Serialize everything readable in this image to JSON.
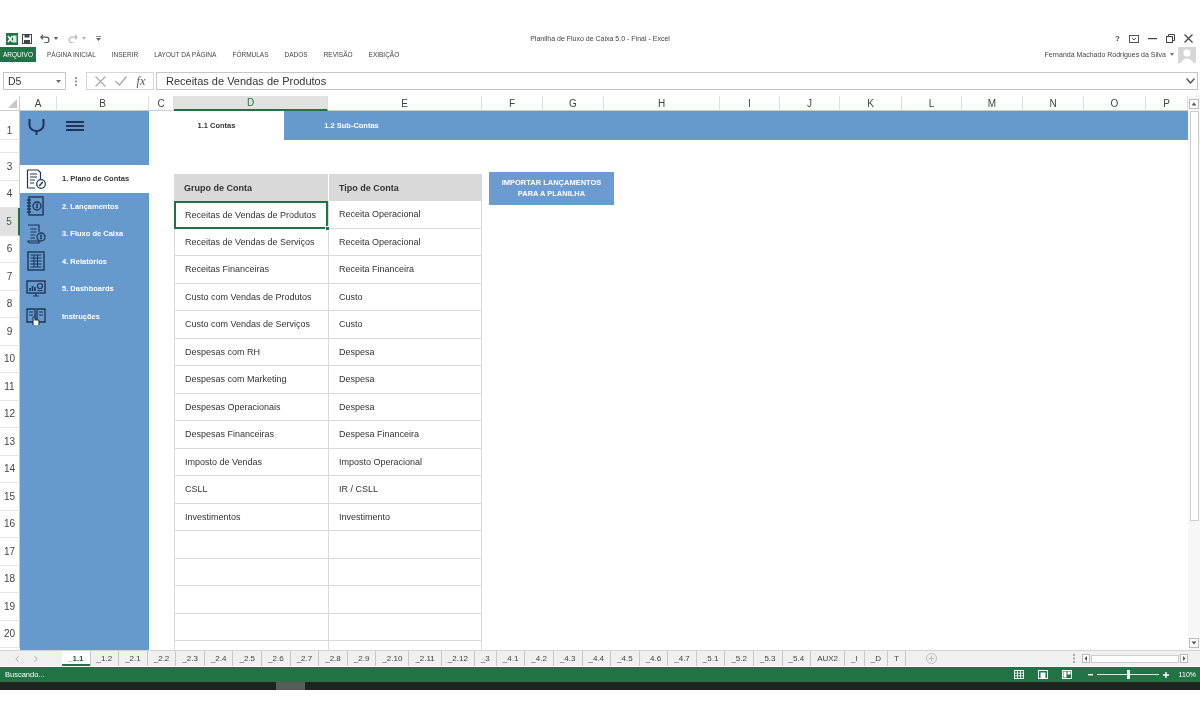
{
  "window": {
    "title": "Planilha de Fluxo de Caixa 5.0 - Final - Excel",
    "help": "?",
    "user": "Fernanda Machado Rodrigues da Silva"
  },
  "quick_access": {
    "undo_disabled": false,
    "redo_disabled": true
  },
  "ribbon_tabs": [
    {
      "label": "ARQUIVO",
      "kind": "file"
    },
    {
      "label": "PÁGINA INICIAL",
      "kind": "tab"
    },
    {
      "label": "INSERIR",
      "kind": "tab"
    },
    {
      "label": "LAYOUT DA PÁGINA",
      "kind": "tab"
    },
    {
      "label": "FÓRMULAS",
      "kind": "tab"
    },
    {
      "label": "DADOS",
      "kind": "tab"
    },
    {
      "label": "REVISÃO",
      "kind": "tab"
    },
    {
      "label": "EXIBIÇÃO",
      "kind": "tab"
    }
  ],
  "formula_bar": {
    "name_box": "D5",
    "insert_function": "fx",
    "formula": "Receitas de Vendas de Produtos"
  },
  "columns": [
    {
      "label": "A",
      "selected": false
    },
    {
      "label": "B",
      "selected": false
    },
    {
      "label": "C",
      "selected": false
    },
    {
      "label": "D",
      "selected": true
    },
    {
      "label": "E",
      "selected": false
    },
    {
      "label": "F",
      "selected": false
    },
    {
      "label": "G",
      "selected": false
    },
    {
      "label": "H",
      "selected": false
    },
    {
      "label": "I",
      "selected": false
    },
    {
      "label": "J",
      "selected": false
    },
    {
      "label": "K",
      "selected": false
    },
    {
      "label": "L",
      "selected": false
    },
    {
      "label": "M",
      "selected": false
    },
    {
      "label": "N",
      "selected": false
    },
    {
      "label": "O",
      "selected": false
    },
    {
      "label": "P",
      "selected": false
    }
  ],
  "rows": [
    {
      "label": "1",
      "selected": false
    },
    {
      "label": "3",
      "selected": false
    },
    {
      "label": "4",
      "selected": false
    },
    {
      "label": "5",
      "selected": true
    },
    {
      "label": "6",
      "selected": false
    },
    {
      "label": "7",
      "selected": false
    },
    {
      "label": "8",
      "selected": false
    },
    {
      "label": "9",
      "selected": false
    },
    {
      "label": "10",
      "selected": false
    },
    {
      "label": "11",
      "selected": false
    },
    {
      "label": "12",
      "selected": false
    },
    {
      "label": "13",
      "selected": false
    },
    {
      "label": "14",
      "selected": false
    },
    {
      "label": "15",
      "selected": false
    },
    {
      "label": "16",
      "selected": false
    },
    {
      "label": "17",
      "selected": false
    },
    {
      "label": "18",
      "selected": false
    },
    {
      "label": "19",
      "selected": false
    },
    {
      "label": "20",
      "selected": false
    }
  ],
  "sidebar": {
    "items": [
      {
        "label": "1. Plano de Contas",
        "selected": true
      },
      {
        "label": "2. Lançamentos",
        "selected": false
      },
      {
        "label": "3. Fluxo de Caixa",
        "selected": false
      },
      {
        "label": "4. Relatórios",
        "selected": false
      },
      {
        "label": "5. Dashboards",
        "selected": false
      },
      {
        "label": "Instruções",
        "selected": false
      }
    ]
  },
  "page_tabs": [
    {
      "label": "1.1 Contas",
      "selected": true
    },
    {
      "label": "1.2 Sub-Contas",
      "selected": false
    }
  ],
  "table": {
    "columns": [
      "Grupo de Conta",
      "Tipo de Conta"
    ],
    "rows": [
      {
        "cells": [
          {
            "text": "Receitas de Vendas de Produtos",
            "selected": true
          },
          {
            "text": "Receita Operacional",
            "selected": false
          }
        ]
      },
      {
        "cells": [
          {
            "text": "Receitas de Vendas de Serviços",
            "selected": false
          },
          {
            "text": "Receita Operacional",
            "selected": false
          }
        ]
      },
      {
        "cells": [
          {
            "text": "Receitas Financeiras",
            "selected": false
          },
          {
            "text": "Receita Financeira",
            "selected": false
          }
        ]
      },
      {
        "cells": [
          {
            "text": "Custo com Vendas de Produtos",
            "selected": false
          },
          {
            "text": "Custo",
            "selected": false
          }
        ]
      },
      {
        "cells": [
          {
            "text": "Custo com Vendas de Serviços",
            "selected": false
          },
          {
            "text": "Custo",
            "selected": false
          }
        ]
      },
      {
        "cells": [
          {
            "text": "Despesas com RH",
            "selected": false
          },
          {
            "text": "Despesa",
            "selected": false
          }
        ]
      },
      {
        "cells": [
          {
            "text": "Despesas com Marketing",
            "selected": false
          },
          {
            "text": "Despesa",
            "selected": false
          }
        ]
      },
      {
        "cells": [
          {
            "text": "Despesas Operacionais",
            "selected": false
          },
          {
            "text": "Despesa",
            "selected": false
          }
        ]
      },
      {
        "cells": [
          {
            "text": "Despesas Financeiras",
            "selected": false
          },
          {
            "text": "Despesa Financeira",
            "selected": false
          }
        ]
      },
      {
        "cells": [
          {
            "text": "Imposto de Vendas",
            "selected": false
          },
          {
            "text": "Imposto Operacional",
            "selected": false
          }
        ]
      },
      {
        "cells": [
          {
            "text": "CSLL",
            "selected": false
          },
          {
            "text": "IR / CSLL",
            "selected": false
          }
        ]
      },
      {
        "cells": [
          {
            "text": "Investimentos",
            "selected": false
          },
          {
            "text": "Investimento",
            "selected": false
          }
        ]
      }
    ]
  },
  "import_button": {
    "label": "IMPORTAR LANÇAMENTOS PARA A PLANILHA"
  },
  "sheet_tabs": [
    {
      "label": "_1.1",
      "selected": true
    },
    {
      "label": "_1.2",
      "selected": false
    },
    {
      "label": "_2.1",
      "selected": false
    },
    {
      "label": "_2.2",
      "selected": false
    },
    {
      "label": "_2.3",
      "selected": false
    },
    {
      "label": "_2.4",
      "selected": false
    },
    {
      "label": "_2.5",
      "selected": false
    },
    {
      "label": "_2.6",
      "selected": false
    },
    {
      "label": "_2.7",
      "selected": false
    },
    {
      "label": "_2.8",
      "selected": false
    },
    {
      "label": "_2.9",
      "selected": false
    },
    {
      "label": "_2.10",
      "selected": false
    },
    {
      "label": "_2.11",
      "selected": false
    },
    {
      "label": "_2.12",
      "selected": false
    },
    {
      "label": "_3",
      "selected": false
    },
    {
      "label": "_4.1",
      "selected": false
    },
    {
      "label": "_4.2",
      "selected": false
    },
    {
      "label": "_4.3",
      "selected": false
    },
    {
      "label": "_4.4",
      "selected": false
    },
    {
      "label": "_4.5",
      "selected": false
    },
    {
      "label": "_4.6",
      "selected": false
    },
    {
      "label": "_4.7",
      "selected": false
    },
    {
      "label": "_5.1",
      "selected": false
    },
    {
      "label": "_5.2",
      "selected": false
    },
    {
      "label": "_5.3",
      "selected": false
    },
    {
      "label": "_5.4",
      "selected": false
    },
    {
      "label": "AUX2",
      "selected": false
    },
    {
      "label": "_I",
      "selected": false
    },
    {
      "label": "_D",
      "selected": false
    },
    {
      "label": "T",
      "selected": false
    }
  ],
  "status_bar": {
    "status": "Buscando...",
    "zoom": {
      "label": "110%",
      "level": 0.52
    }
  }
}
